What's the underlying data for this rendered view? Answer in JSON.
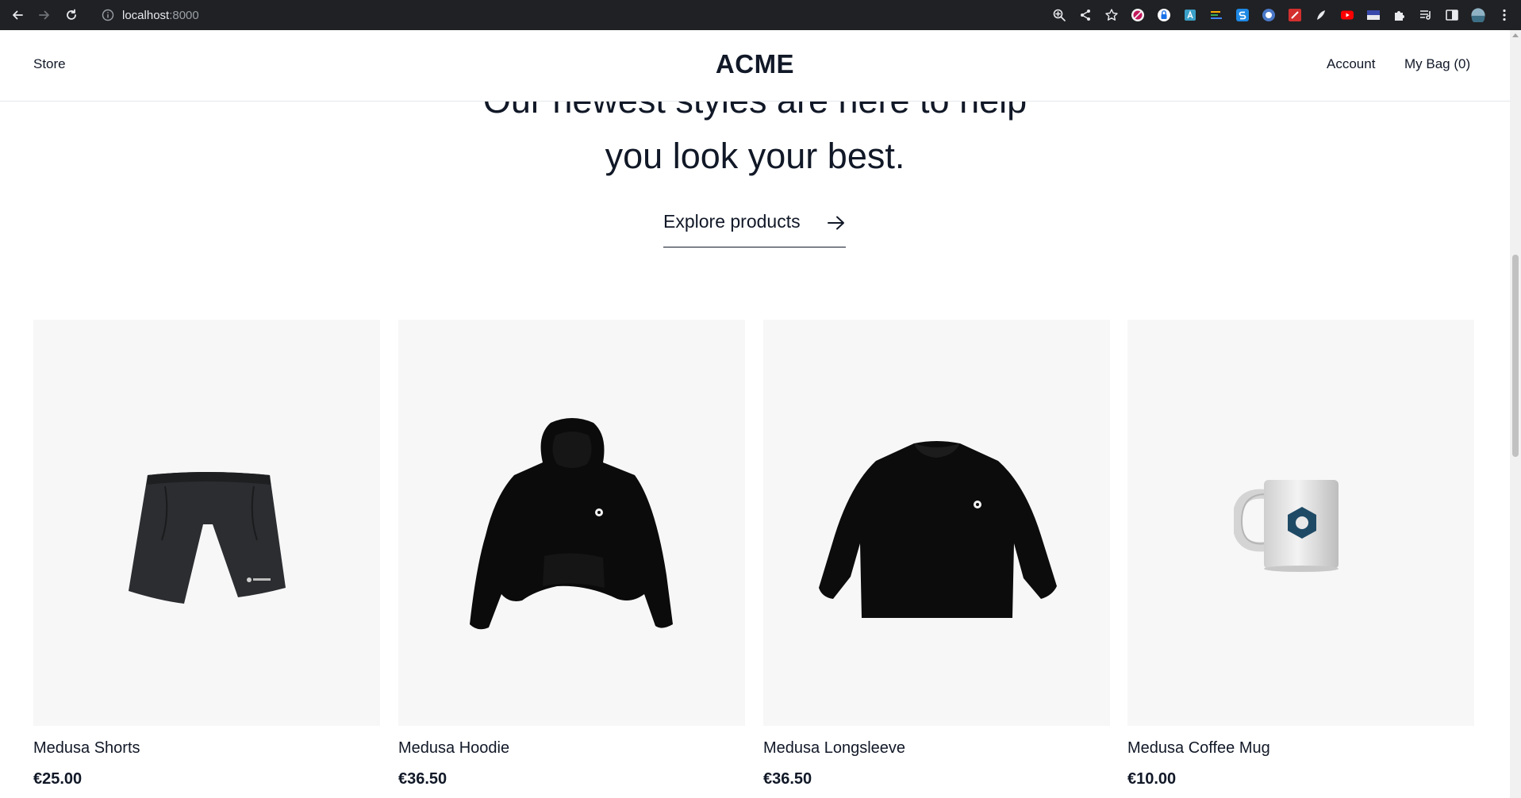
{
  "browser": {
    "url_host": "localhost",
    "url_port": ":8000"
  },
  "header": {
    "store_label": "Store",
    "logo": "ACME",
    "account_label": "Account",
    "bag_label": "My Bag (0)"
  },
  "hero": {
    "line1": "Our newest styles are here to help",
    "line2": "you look your best.",
    "cta_label": "Explore products"
  },
  "products": [
    {
      "name": "Medusa Shorts",
      "price": "€25.00",
      "image": "shorts"
    },
    {
      "name": "Medusa Hoodie",
      "price": "€36.50",
      "image": "hoodie"
    },
    {
      "name": "Medusa Longsleeve",
      "price": "€36.50",
      "image": "longsleeve"
    },
    {
      "name": "Medusa Coffee Mug",
      "price": "€10.00",
      "image": "mug"
    }
  ],
  "colors": {
    "text": "#111827",
    "thumb_bg": "#f7f7f8",
    "chrome_bg": "#202124",
    "mug_logo": "#1f4a66"
  }
}
